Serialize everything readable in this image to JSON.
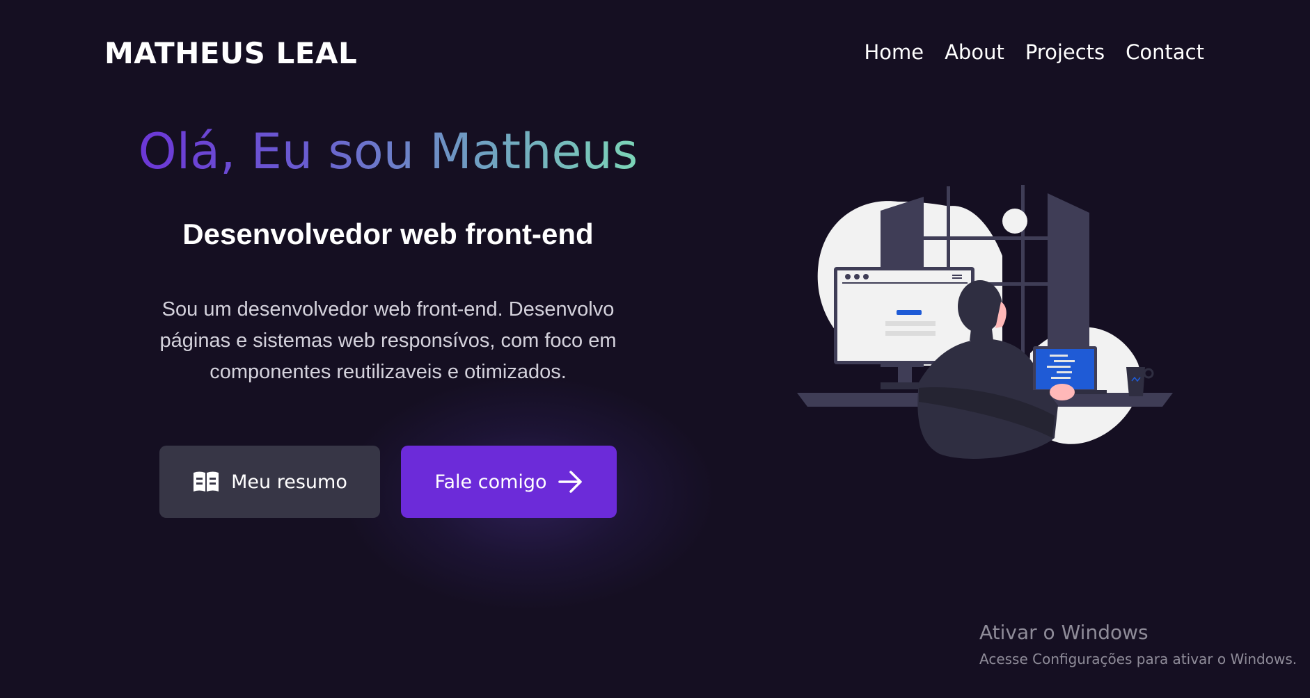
{
  "header": {
    "logo": "MATHEUS LEAL",
    "nav": [
      {
        "label": "Home"
      },
      {
        "label": "About"
      },
      {
        "label": "Projects"
      },
      {
        "label": "Contact"
      }
    ]
  },
  "hero": {
    "greeting": "Olá, Eu sou Matheus",
    "role": "Desenvolvedor web front-end",
    "bio": "Sou um desenvolvedor web front-end. Desenvolvo páginas e sistemas web responsívos, com foco em componentes reutilizaveis e otimizados."
  },
  "buttons": {
    "resume_label": "Meu resumo",
    "resume_icon": "book-icon",
    "contact_label": "Fale comigo",
    "contact_icon": "arrow-right-icon"
  },
  "illustration": {
    "icon": "developer-at-desk-illustration"
  },
  "watermark": {
    "title": "Ativar o Windows",
    "subtitle": "Acesse Configurações para ativar o Windows."
  },
  "colors": {
    "background": "#150f22",
    "primary": "#6c2bd9",
    "secondary_button": "#373646",
    "gradient_start": "#6d2fd8",
    "gradient_end": "#7fe0b5",
    "screen_blue": "#1f5bd6"
  }
}
